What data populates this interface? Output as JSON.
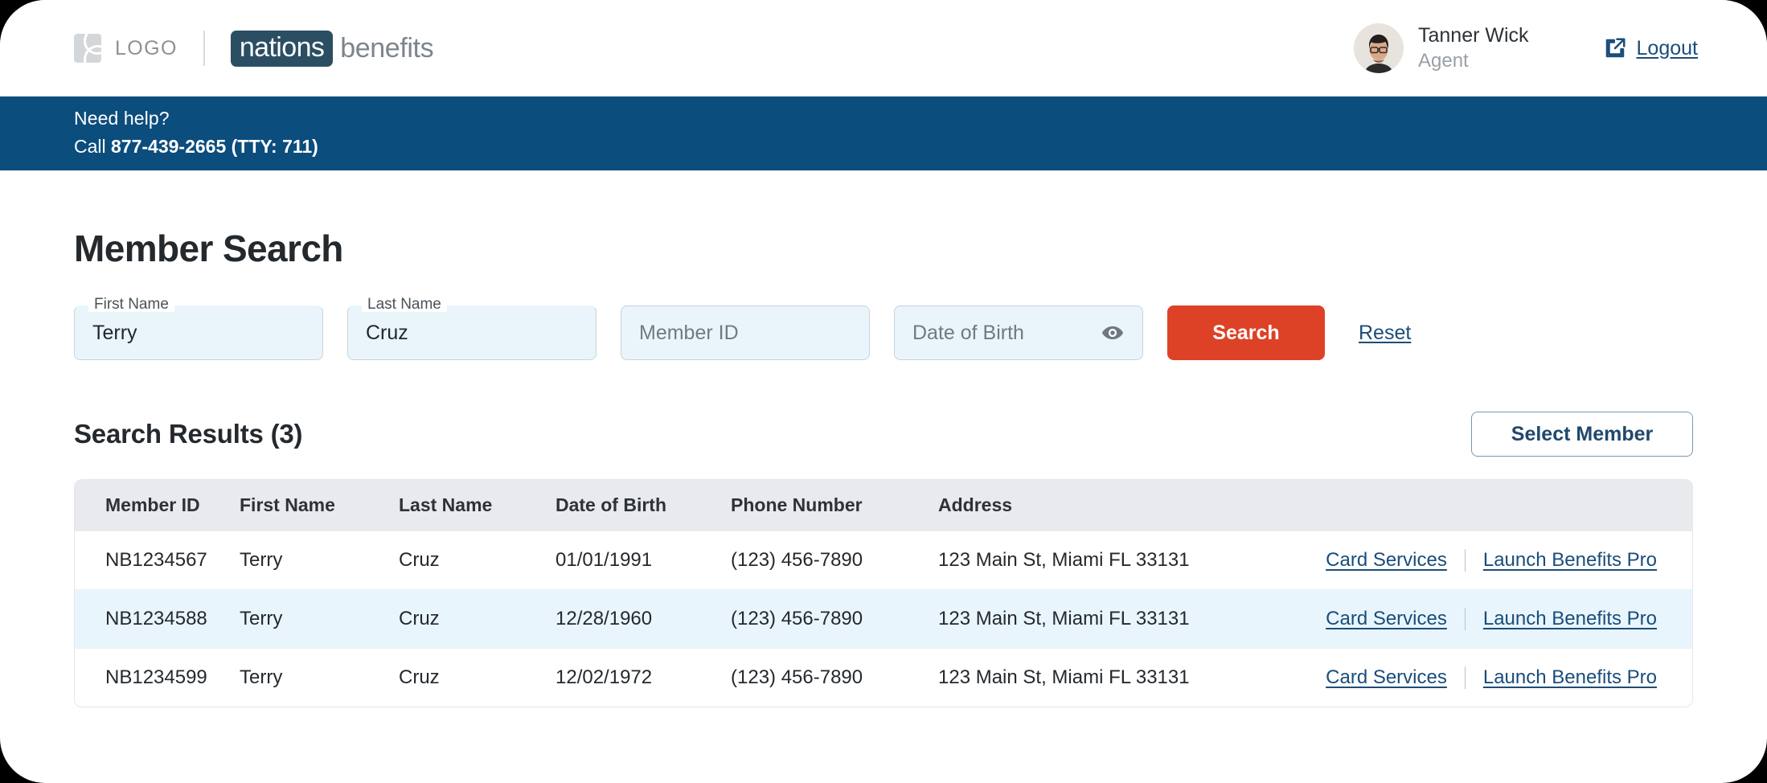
{
  "header": {
    "logo_text": "LOGO",
    "brand_primary": "nations",
    "brand_secondary": "benefits",
    "user": {
      "name": "Tanner Wick",
      "role": "Agent",
      "avatar_icon": "user-avatar-photo"
    },
    "logout": {
      "label": "Logout",
      "icon": "external-link-icon"
    }
  },
  "help_banner": {
    "title": "Need help?",
    "call_prefix": "Call ",
    "phone": "877-439-2665 (TTY: 711)",
    "background": "#0b4d7d"
  },
  "page": {
    "title": "Member Search"
  },
  "search_form": {
    "fields": [
      {
        "name": "first-name",
        "label": "First Name",
        "value": "Terry",
        "placeholder": "First Name",
        "filled": true
      },
      {
        "name": "last-name",
        "label": "Last Name",
        "value": "Cruz",
        "placeholder": "Last Name",
        "filled": true
      },
      {
        "name": "member-id",
        "label": "Member ID",
        "value": "",
        "placeholder": "Member ID",
        "filled": false
      },
      {
        "name": "date-of-birth",
        "label": "Date of Birth",
        "value": "",
        "placeholder": "Date of Birth",
        "filled": false,
        "icon": "eye-icon"
      }
    ],
    "search_label": "Search",
    "reset_label": "Reset",
    "search_color": "#dd4226"
  },
  "results": {
    "title": "Search Results (3)",
    "count": 3,
    "select_member_label": "Select Member",
    "columns": [
      "Member ID",
      "First Name",
      "Last Name",
      "Date of Birth",
      "Phone Number",
      "Address"
    ],
    "action_labels": {
      "card_services": "Card Services",
      "launch_benefits_pro": "Launch Benefits Pro"
    },
    "rows": [
      {
        "member_id": "NB1234567",
        "first_name": "Terry",
        "last_name": "Cruz",
        "date_of_birth": "01/01/1991",
        "phone_number": "(123) 456-7890",
        "address": "123 Main St, Miami FL 33131",
        "highlighted": false
      },
      {
        "member_id": "NB1234588",
        "first_name": "Terry",
        "last_name": "Cruz",
        "date_of_birth": "12/28/1960",
        "phone_number": "(123) 456-7890",
        "address": "123 Main St, Miami FL 33131",
        "highlighted": true
      },
      {
        "member_id": "NB1234599",
        "first_name": "Terry",
        "last_name": "Cruz",
        "date_of_birth": "12/02/1972",
        "phone_number": "(123) 456-7890",
        "address": "123 Main St, Miami FL 33131",
        "highlighted": false
      }
    ]
  }
}
